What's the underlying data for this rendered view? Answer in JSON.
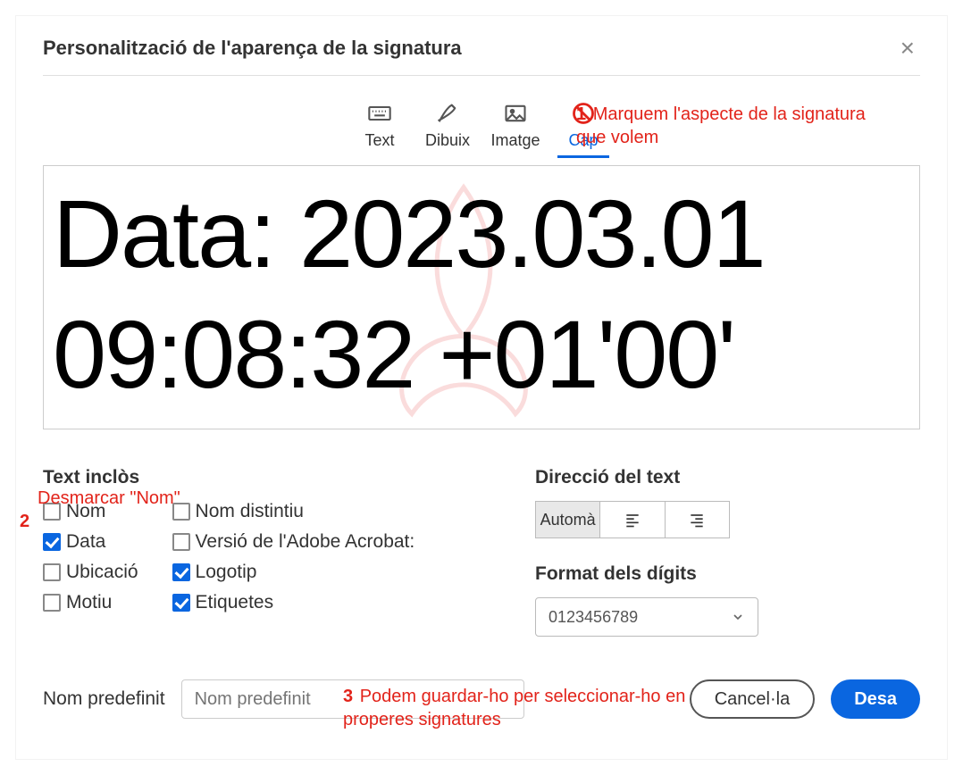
{
  "title": "Personalització de l'aparença de la signatura",
  "tabs": {
    "text": "Text",
    "draw": "Dibuix",
    "image": "Imatge",
    "none": "Cap"
  },
  "annotations": {
    "a1_num": "1",
    "a1_text": "Marquem l'aspecte de la signatura que volem",
    "a2_num": "2",
    "a2_unmark": "Desmarcar \"Nom\"",
    "a3_num": "3",
    "a3_text": "Podem guardar-ho per seleccionar-ho en properes signatures"
  },
  "preview": {
    "line1": "Data: 2023.03.01",
    "line2": "09:08:32 +01'00'"
  },
  "includedText": {
    "heading": "Text inclòs",
    "items": {
      "name": {
        "label": "Nom",
        "checked": false
      },
      "date": {
        "label": "Data",
        "checked": true
      },
      "location": {
        "label": "Ubicació",
        "checked": false
      },
      "reason": {
        "label": "Motiu",
        "checked": false
      },
      "dn": {
        "label": "Nom distintiu",
        "checked": false
      },
      "version": {
        "label": "Versió de l'Adobe Acrobat:",
        "checked": false
      },
      "logo": {
        "label": "Logotip",
        "checked": true
      },
      "labels": {
        "label": "Etiquetes",
        "checked": true
      }
    }
  },
  "textDirection": {
    "heading": "Direcció del text",
    "auto": "Automà"
  },
  "digitFormat": {
    "heading": "Format dels dígits",
    "value": "0123456789"
  },
  "footer": {
    "presetLabel": "Nom predefinit",
    "presetPlaceholder": "Nom predefinit",
    "cancel": "Cancel·la",
    "save": "Desa"
  }
}
